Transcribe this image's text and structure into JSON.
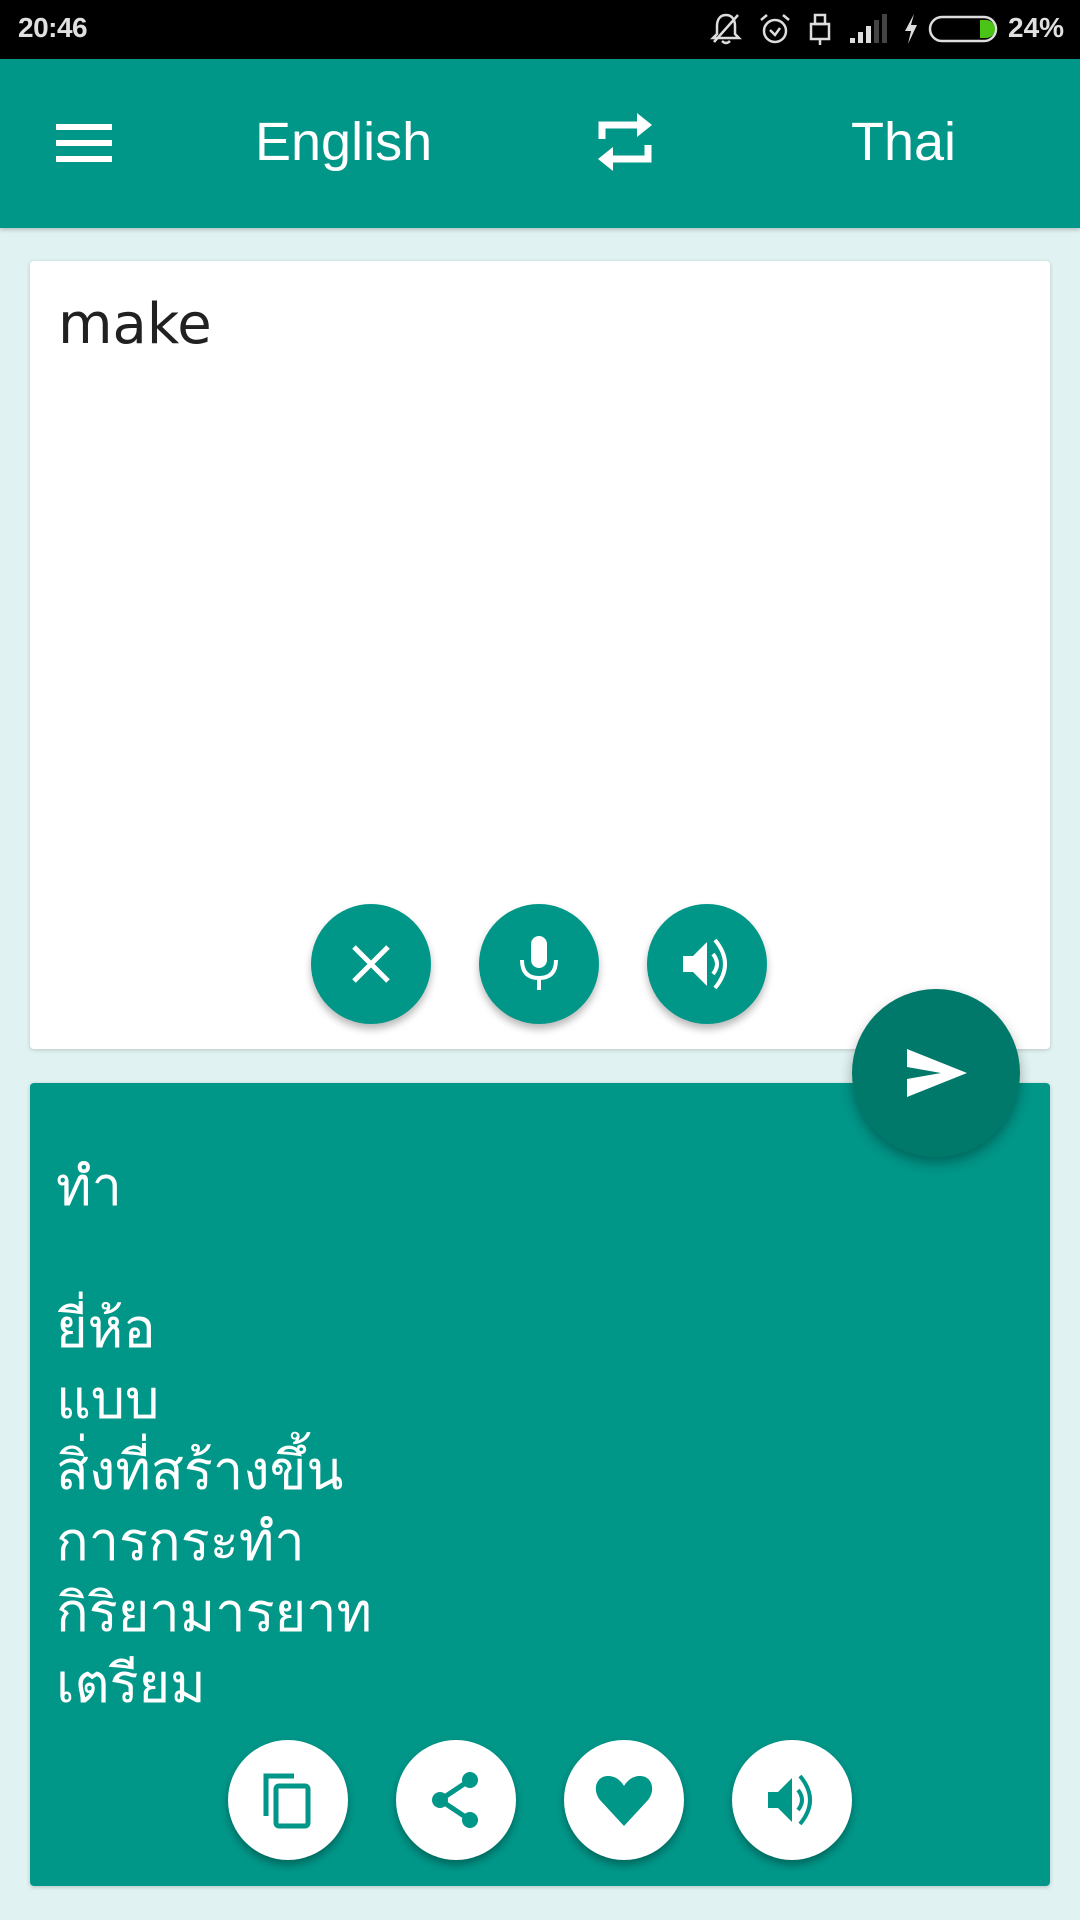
{
  "status_bar": {
    "time": "20:46",
    "battery_percent": "24%",
    "battery_level": 0.24,
    "icons": [
      "notifications-off-icon",
      "alarm-icon",
      "usb-lock-icon",
      "signal-icon",
      "charging-bolt-icon",
      "battery-icon"
    ]
  },
  "app_bar": {
    "menu_icon": "hamburger-menu-icon",
    "source_language": "English",
    "swap_icon": "swap-languages-icon",
    "target_language": "Thai"
  },
  "input_card": {
    "text": "make",
    "buttons": [
      {
        "name": "clear-button",
        "icon": "close-icon"
      },
      {
        "name": "microphone-button",
        "icon": "microphone-icon"
      },
      {
        "name": "speak-input-button",
        "icon": "speaker-icon"
      }
    ]
  },
  "translate_button": {
    "icon": "send-icon"
  },
  "output_card": {
    "primary": "ทำ",
    "alternatives": [
      "ยี่ห้อ",
      "แบบ",
      "สิ่งที่สร้างขึ้น",
      "การกระทำ",
      "กิริยามารยาท",
      "เตรียม"
    ],
    "buttons": [
      {
        "name": "copy-button",
        "icon": "copy-icon"
      },
      {
        "name": "share-button",
        "icon": "share-icon"
      },
      {
        "name": "favorite-button",
        "icon": "heart-icon"
      },
      {
        "name": "speak-output-button",
        "icon": "speaker-icon"
      }
    ]
  },
  "colors": {
    "primary": "#009688",
    "primary_dark": "#00796b",
    "background": "#e0f2f1",
    "battery_fill": "#4cc417"
  }
}
